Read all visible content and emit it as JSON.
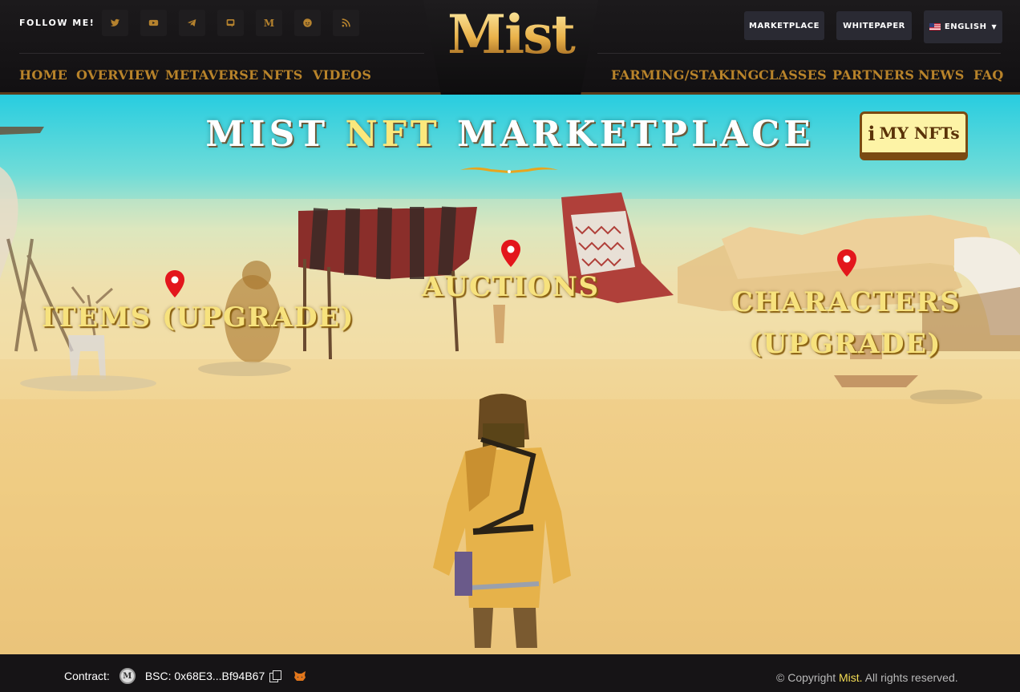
{
  "header": {
    "follow_label": "FOLLOW ME!",
    "social": [
      {
        "name": "twitter-icon"
      },
      {
        "name": "youtube-icon"
      },
      {
        "name": "telegram-icon"
      },
      {
        "name": "discord-icon"
      },
      {
        "name": "medium-icon",
        "glyph": "M"
      },
      {
        "name": "reddit-icon"
      },
      {
        "name": "rss-icon"
      }
    ],
    "logo_text": "Mist",
    "marketplace_label": "MARKETPLACE",
    "whitepaper_label": "WHITEPAPER",
    "language_label": "ENGLISH",
    "nav_left": [
      "HOME",
      "OVERVIEW",
      "METAVERSE",
      "NFTS",
      "VIDEOS"
    ],
    "nav_right": [
      "FARMING/STAKING",
      "CLASSES",
      "PARTNERS",
      "NEWS",
      "FAQ"
    ]
  },
  "hero": {
    "title_part1": "MIST",
    "title_part2": "NFT",
    "title_part3": "MARKETPLACE",
    "my_nfts_icon": "i",
    "my_nfts_label": "MY NFTs",
    "locations": {
      "items": "ITEMS (UPGRADE)",
      "auctions": "AUCTIONS",
      "characters_line1": "CHARACTERS",
      "characters_line2": "(UPGRADE)"
    }
  },
  "footer": {
    "contract_label": "Contract:",
    "coin_glyph": "M",
    "contract_value": "BSC: 0x68E3...Bf94B67",
    "copyright_prefix": "© Copyright ",
    "copyright_brand": "Mist.",
    "copyright_suffix": " All rights reserved."
  },
  "colors": {
    "nav": "#b8832a",
    "title_highlight": "#fbe87c",
    "location_text": "#f7e27d",
    "pin": "#e3161c",
    "brand_footer": "#f4dd55"
  }
}
